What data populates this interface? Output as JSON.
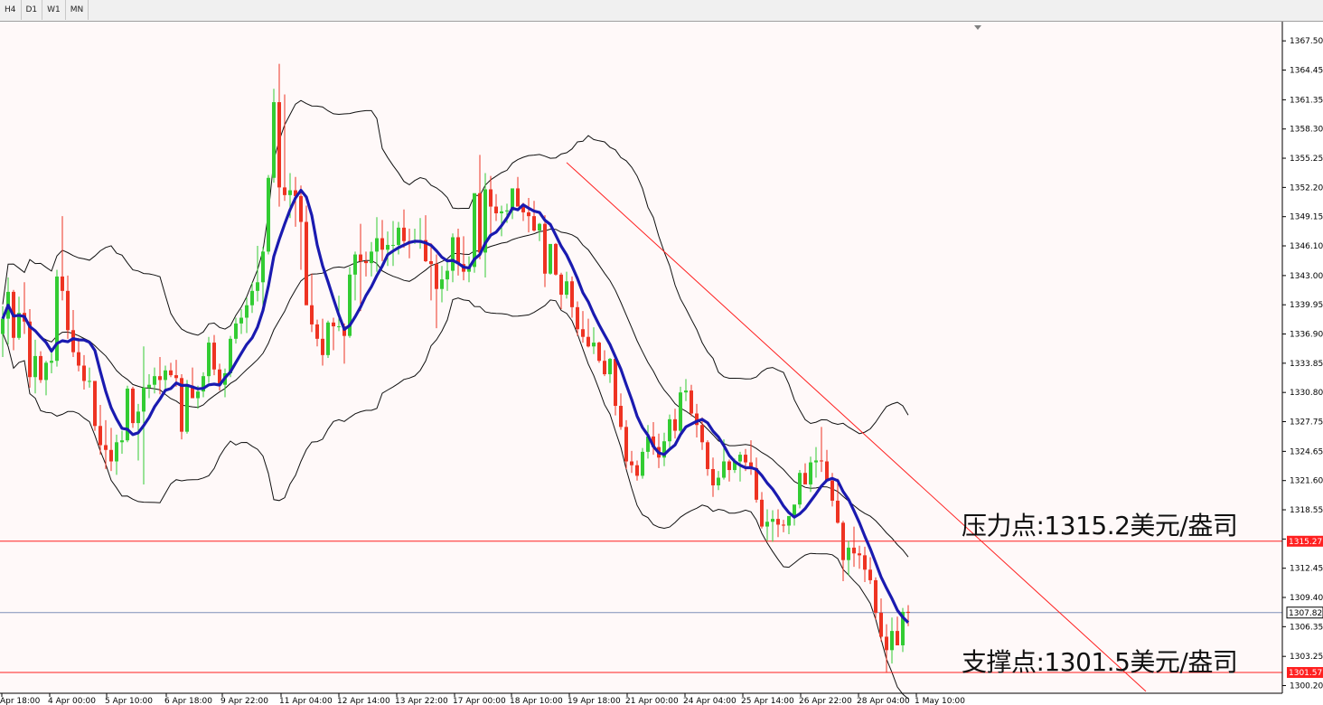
{
  "toolbar": {
    "timeframes": [
      "H4",
      "D1",
      "W1",
      "MN"
    ]
  },
  "annotations": {
    "resistance": "压力点:1315.2美元/盎司",
    "support": "支撑点:1301.5美元/盎司"
  },
  "colors": {
    "bull": "#33cc33",
    "bear": "#ee3322",
    "ma": "#1a1ab0",
    "band": "#111111",
    "trendline": "#ff2020",
    "hline": "#ff2020",
    "price_line": "#7f8fb8",
    "background": "#fff9f9"
  },
  "chart_data": {
    "type": "candlestick",
    "timeframe": "H4",
    "ylim": [
      1299.4,
      1369.5
    ],
    "y_ticks": [
      "1367.50",
      "1364.45",
      "1361.35",
      "1358.30",
      "1355.25",
      "1352.20",
      "1349.15",
      "1346.10",
      "1343.00",
      "1339.95",
      "1336.90",
      "1333.85",
      "1330.80",
      "1327.75",
      "1324.65",
      "1321.60",
      "1318.55",
      "1315.50",
      "1312.45",
      "1309.40",
      "1306.35",
      "1303.25",
      "1300.20"
    ],
    "x_ticks": [
      "Apr 18:00",
      "4 Apr 00:00",
      "5 Apr 10:00",
      "6 Apr 18:00",
      "9 Apr 22:00",
      "11 Apr 04:00",
      "12 Apr 14:00",
      "13 Apr 22:00",
      "17 Apr 00:00",
      "18 Apr 10:00",
      "19 Apr 18:00",
      "21 Apr 00:00",
      "24 Apr 04:00",
      "25 Apr 14:00",
      "26 Apr 22:00",
      "28 Apr 04:00",
      "1 May 10:00"
    ],
    "current_price": "1307.82",
    "resistance": {
      "value": 1315.27,
      "label": "1315.27"
    },
    "support": {
      "value": 1301.57,
      "label": "1301.57"
    },
    "trendline": {
      "from_bar": 104,
      "from_price": 1354.8,
      "to_bar": 211,
      "to_price": 1299.6
    },
    "candles": [
      [
        1336.9,
        1339.8,
        1334.5,
        1338.5
      ],
      [
        1338.5,
        1342.8,
        1335.8,
        1341.3
      ],
      [
        1341.3,
        1341.5,
        1335.2,
        1336.5
      ],
      [
        1336.5,
        1340.8,
        1336.3,
        1339.1
      ],
      [
        1339.1,
        1342.3,
        1336.9,
        1338.2
      ],
      [
        1338.2,
        1339.5,
        1331.3,
        1332.4
      ],
      [
        1332.4,
        1336.3,
        1330.7,
        1334.6
      ],
      [
        1334.6,
        1335.1,
        1331.8,
        1332.1
      ],
      [
        1332.1,
        1334.1,
        1330.5,
        1333.9
      ],
      [
        1333.9,
        1335.0,
        1332.8,
        1334.1
      ],
      [
        1334.1,
        1343.6,
        1333.5,
        1342.9
      ],
      [
        1342.9,
        1349.2,
        1340.4,
        1341.4
      ],
      [
        1341.4,
        1343.0,
        1336.4,
        1337.3
      ],
      [
        1337.3,
        1339.4,
        1334.5,
        1335.0
      ],
      [
        1335.0,
        1336.5,
        1333.0,
        1333.6
      ],
      [
        1333.6,
        1334.7,
        1331.1,
        1332.0
      ],
      [
        1332.0,
        1333.4,
        1331.3,
        1332.0
      ],
      [
        1332.0,
        1332.0,
        1326.8,
        1327.3
      ],
      [
        1327.3,
        1329.5,
        1324.3,
        1325.3
      ],
      [
        1325.3,
        1327.9,
        1322.8,
        1324.8
      ],
      [
        1324.8,
        1327.1,
        1322.6,
        1323.6
      ],
      [
        1323.6,
        1326.4,
        1322.2,
        1325.6
      ],
      [
        1325.6,
        1326.8,
        1324.4,
        1325.8
      ],
      [
        1325.8,
        1331.5,
        1325.6,
        1331.2
      ],
      [
        1331.2,
        1331.4,
        1327.1,
        1327.6
      ],
      [
        1327.6,
        1329.6,
        1323.7,
        1328.8
      ],
      [
        1328.8,
        1335.6,
        1321.2,
        1331.3
      ],
      [
        1331.3,
        1332.7,
        1330.2,
        1331.6
      ],
      [
        1331.6,
        1333.4,
        1330.7,
        1332.5
      ],
      [
        1332.5,
        1334.5,
        1330.6,
        1332.1
      ],
      [
        1332.1,
        1333.6,
        1330.9,
        1333.1
      ],
      [
        1333.1,
        1333.9,
        1332.4,
        1332.6
      ],
      [
        1332.6,
        1334.2,
        1331.4,
        1332.3
      ],
      [
        1332.3,
        1332.7,
        1325.9,
        1326.7
      ],
      [
        1326.7,
        1332.1,
        1326.5,
        1331.5
      ],
      [
        1331.5,
        1333.4,
        1330.2,
        1330.2
      ],
      [
        1330.2,
        1331.5,
        1329.1,
        1330.9
      ],
      [
        1330.9,
        1332.9,
        1330.3,
        1332.5
      ],
      [
        1332.5,
        1336.6,
        1331.8,
        1336.0
      ],
      [
        1336.0,
        1336.8,
        1332.6,
        1333.2
      ],
      [
        1333.2,
        1333.8,
        1331.0,
        1331.6
      ],
      [
        1331.6,
        1333.3,
        1330.3,
        1332.8
      ],
      [
        1332.8,
        1336.7,
        1332.4,
        1336.4
      ],
      [
        1336.4,
        1338.6,
        1335.9,
        1338.0
      ],
      [
        1338.0,
        1339.5,
        1336.9,
        1338.6
      ],
      [
        1338.6,
        1340.7,
        1337.0,
        1339.9
      ],
      [
        1339.9,
        1342.3,
        1339.1,
        1341.4
      ],
      [
        1341.4,
        1346.1,
        1340.3,
        1342.3
      ],
      [
        1342.3,
        1346.0,
        1339.6,
        1345.5
      ],
      [
        1345.5,
        1353.5,
        1345.2,
        1353.2
      ],
      [
        1353.2,
        1362.5,
        1352.7,
        1361.1
      ],
      [
        1361.1,
        1365.1,
        1350.2,
        1352.2
      ],
      [
        1352.2,
        1361.9,
        1350.8,
        1351.4
      ],
      [
        1351.4,
        1353.7,
        1349.0,
        1351.9
      ],
      [
        1351.9,
        1353.3,
        1348.1,
        1351.3
      ],
      [
        1351.3,
        1352.4,
        1343.6,
        1348.6
      ],
      [
        1348.6,
        1350.3,
        1343.0,
        1339.9
      ],
      [
        1339.9,
        1343.2,
        1337.1,
        1337.9
      ],
      [
        1337.9,
        1338.4,
        1335.6,
        1336.4
      ],
      [
        1336.4,
        1338.5,
        1333.6,
        1334.7
      ],
      [
        1334.7,
        1338.3,
        1334.4,
        1338.1
      ],
      [
        1338.1,
        1338.6,
        1335.2,
        1337.7
      ],
      [
        1337.7,
        1340.9,
        1337.2,
        1337.7
      ],
      [
        1337.7,
        1338.0,
        1333.8,
        1336.7
      ],
      [
        1336.7,
        1343.9,
        1336.5,
        1343.1
      ],
      [
        1343.1,
        1345.5,
        1340.4,
        1345.2
      ],
      [
        1345.2,
        1348.4,
        1339.3,
        1344.5
      ],
      [
        1344.5,
        1345.5,
        1342.9,
        1344.3
      ],
      [
        1344.3,
        1346.5,
        1342.9,
        1345.5
      ],
      [
        1345.5,
        1349.1,
        1343.4,
        1346.9
      ],
      [
        1346.9,
        1348.8,
        1344.5,
        1345.7
      ],
      [
        1345.7,
        1347.6,
        1344.0,
        1346.2
      ],
      [
        1346.2,
        1348.7,
        1344.0,
        1346.2
      ],
      [
        1346.2,
        1348.6,
        1345.2,
        1348.0
      ],
      [
        1348.0,
        1349.9,
        1345.9,
        1346.6
      ],
      [
        1346.6,
        1347.9,
        1344.8,
        1346.5
      ],
      [
        1346.5,
        1347.9,
        1346.3,
        1346.6
      ],
      [
        1346.6,
        1349.0,
        1345.8,
        1346.7
      ],
      [
        1346.7,
        1349.3,
        1344.4,
        1344.5
      ],
      [
        1344.5,
        1346.4,
        1340.4,
        1344.2
      ],
      [
        1344.2,
        1345.2,
        1337.5,
        1341.6
      ],
      [
        1341.6,
        1344.0,
        1340.2,
        1342.6
      ],
      [
        1342.6,
        1344.5,
        1341.4,
        1343.5
      ],
      [
        1343.5,
        1347.4,
        1342.3,
        1347.0
      ],
      [
        1347.0,
        1347.9,
        1343.0,
        1344.2
      ],
      [
        1344.2,
        1347.1,
        1342.5,
        1343.4
      ],
      [
        1343.4,
        1345.0,
        1342.3,
        1343.9
      ],
      [
        1343.9,
        1350.2,
        1343.3,
        1351.6
      ],
      [
        1351.6,
        1355.6,
        1344.7,
        1345.4
      ],
      [
        1345.4,
        1353.7,
        1342.8,
        1352.0
      ],
      [
        1352.0,
        1353.4,
        1347.4,
        1350.2
      ],
      [
        1350.2,
        1351.5,
        1348.7,
        1349.5
      ],
      [
        1349.5,
        1350.3,
        1347.1,
        1349.7
      ],
      [
        1349.7,
        1350.5,
        1348.5,
        1349.8
      ],
      [
        1349.8,
        1350.9,
        1348.9,
        1352.1
      ],
      [
        1352.1,
        1353.3,
        1350.6,
        1350.2
      ],
      [
        1350.2,
        1350.6,
        1348.7,
        1349.6
      ],
      [
        1349.6,
        1351.1,
        1347.5,
        1349.2
      ],
      [
        1349.2,
        1350.8,
        1347.6,
        1347.7
      ],
      [
        1347.7,
        1348.5,
        1346.6,
        1348.4
      ],
      [
        1348.4,
        1349.3,
        1341.8,
        1343.2
      ],
      [
        1343.2,
        1346.2,
        1343.1,
        1346.3
      ],
      [
        1346.3,
        1346.4,
        1343.0,
        1343.1
      ],
      [
        1343.1,
        1343.3,
        1339.5,
        1341.0
      ],
      [
        1341.0,
        1343.4,
        1340.6,
        1342.4
      ],
      [
        1342.4,
        1342.9,
        1338.6,
        1339.7
      ],
      [
        1339.7,
        1340.3,
        1336.7,
        1337.4
      ],
      [
        1337.4,
        1339.3,
        1336.0,
        1336.6
      ],
      [
        1336.6,
        1338.5,
        1335.5,
        1335.6
      ],
      [
        1335.6,
        1337.6,
        1334.8,
        1336.0
      ],
      [
        1336.0,
        1336.1,
        1333.9,
        1334.1
      ],
      [
        1334.1,
        1335.2,
        1332.5,
        1332.7
      ],
      [
        1332.7,
        1334.4,
        1331.8,
        1334.3
      ],
      [
        1334.3,
        1334.4,
        1328.4,
        1329.4
      ],
      [
        1329.4,
        1330.7,
        1326.9,
        1327.2
      ],
      [
        1327.2,
        1327.9,
        1322.8,
        1323.6
      ],
      [
        1323.6,
        1324.7,
        1322.4,
        1323.2
      ],
      [
        1323.2,
        1323.7,
        1321.6,
        1322.1
      ],
      [
        1322.1,
        1325.0,
        1321.8,
        1324.6
      ],
      [
        1324.6,
        1327.4,
        1323.9,
        1326.2
      ],
      [
        1326.2,
        1327.7,
        1324.3,
        1325.1
      ],
      [
        1325.1,
        1326.5,
        1322.9,
        1324.0
      ],
      [
        1324.0,
        1326.6,
        1323.1,
        1325.7
      ],
      [
        1325.7,
        1328.5,
        1324.7,
        1328.0
      ],
      [
        1328.0,
        1329.1,
        1326.0,
        1326.8
      ],
      [
        1326.8,
        1331.4,
        1326.3,
        1330.8
      ],
      [
        1330.8,
        1332.2,
        1329.9,
        1331.0
      ],
      [
        1331.0,
        1331.6,
        1328.3,
        1328.6
      ],
      [
        1328.6,
        1329.6,
        1326.1,
        1327.4
      ],
      [
        1327.4,
        1328.2,
        1324.8,
        1325.6
      ],
      [
        1325.6,
        1325.8,
        1322.1,
        1322.8
      ],
      [
        1322.8,
        1324.0,
        1319.9,
        1321.1
      ],
      [
        1321.1,
        1322.6,
        1320.6,
        1321.9
      ],
      [
        1321.9,
        1325.9,
        1321.7,
        1323.6
      ],
      [
        1323.6,
        1323.8,
        1321.5,
        1322.7
      ],
      [
        1322.7,
        1323.9,
        1322.4,
        1323.6
      ],
      [
        1323.6,
        1324.6,
        1321.5,
        1324.3
      ],
      [
        1324.3,
        1324.9,
        1322.6,
        1323.5
      ],
      [
        1323.5,
        1325.8,
        1322.2,
        1322.9
      ],
      [
        1322.9,
        1324.0,
        1319.3,
        1319.6
      ],
      [
        1319.6,
        1320.4,
        1316.6,
        1316.8
      ],
      [
        1316.8,
        1318.6,
        1315.3,
        1317.3
      ],
      [
        1317.3,
        1318.5,
        1315.2,
        1317.6
      ],
      [
        1317.6,
        1318.6,
        1315.7,
        1317.0
      ],
      [
        1317.0,
        1317.5,
        1316.2,
        1316.9
      ],
      [
        1316.9,
        1317.7,
        1316.0,
        1317.9
      ],
      [
        1317.9,
        1318.7,
        1316.9,
        1319.1
      ],
      [
        1319.1,
        1322.7,
        1318.7,
        1322.4
      ],
      [
        1322.4,
        1323.4,
        1321.5,
        1321.2
      ],
      [
        1321.2,
        1324.1,
        1320.4,
        1323.5
      ],
      [
        1323.5,
        1325.1,
        1321.9,
        1323.7
      ],
      [
        1323.7,
        1327.2,
        1322.5,
        1323.6
      ],
      [
        1323.6,
        1324.8,
        1321.5,
        1321.6
      ],
      [
        1321.6,
        1322.4,
        1318.9,
        1319.5
      ],
      [
        1319.5,
        1321.8,
        1317.1,
        1317.2
      ],
      [
        1317.2,
        1317.4,
        1311.1,
        1313.3
      ],
      [
        1313.3,
        1315.3,
        1311.7,
        1314.6
      ],
      [
        1314.6,
        1316.8,
        1312.6,
        1314.0
      ],
      [
        1314.0,
        1314.8,
        1312.4,
        1313.8
      ],
      [
        1313.8,
        1314.7,
        1311.0,
        1312.3
      ],
      [
        1312.3,
        1313.6,
        1310.8,
        1311.2
      ],
      [
        1311.2,
        1311.5,
        1307.1,
        1307.8
      ],
      [
        1307.8,
        1309.3,
        1304.8,
        1305.3
      ],
      [
        1305.3,
        1306.6,
        1301.6,
        1303.9
      ],
      [
        1303.9,
        1307.3,
        1302.5,
        1305.9
      ],
      [
        1305.9,
        1307.4,
        1304.5,
        1304.4
      ],
      [
        1304.4,
        1308.3,
        1303.7,
        1307.9
      ],
      [
        1307.9,
        1308.6,
        1306.4,
        1307.8
      ]
    ]
  }
}
